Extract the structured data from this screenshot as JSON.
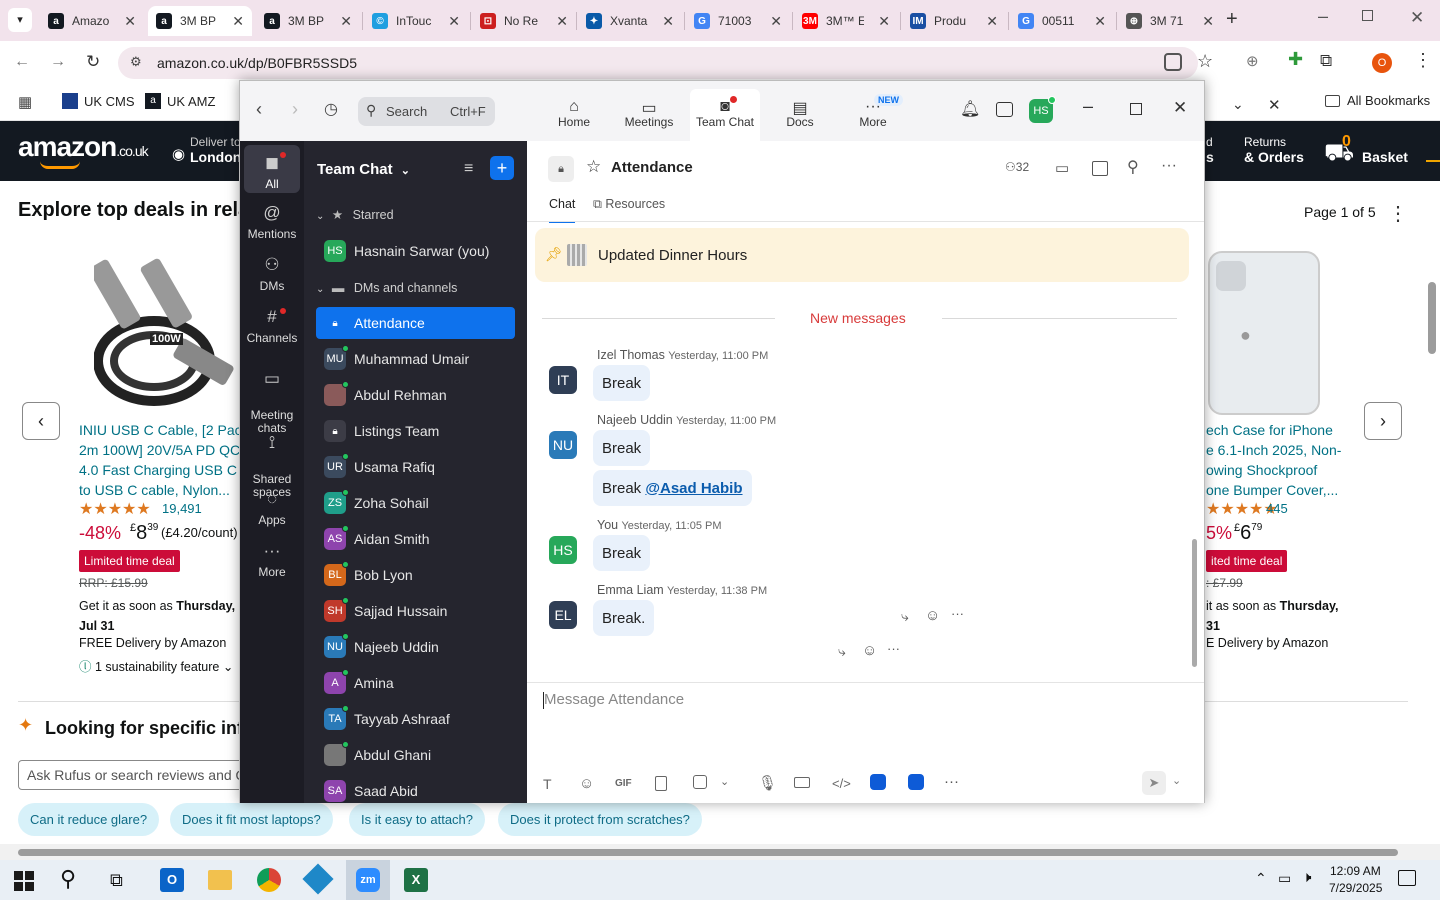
{
  "browser": {
    "tabs": [
      {
        "label": "Amazo",
        "color": "#131921",
        "fav": "a"
      },
      {
        "label": "3M BP",
        "color": "#131921",
        "fav": "a"
      },
      {
        "label": "3M BP",
        "color": "#131921",
        "fav": "a"
      },
      {
        "label": "InTouc",
        "color": "#1f9fe0",
        "fav": "©"
      },
      {
        "label": "No Re",
        "color": "#cc1f1f",
        "fav": "⊡"
      },
      {
        "label": "Xvanta",
        "color": "#0a5aa8",
        "fav": "✦"
      },
      {
        "label": "71003",
        "color": "#4285f4",
        "fav": "G"
      },
      {
        "label": "3M™ E",
        "color": "#ff0000",
        "fav": "3M"
      },
      {
        "label": "Produ",
        "color": "#1a4fa3",
        "fav": "IM"
      },
      {
        "label": "00511",
        "color": "#4285f4",
        "fav": "G"
      },
      {
        "label": "3M 71",
        "color": "#555555",
        "fav": "⊕"
      }
    ],
    "new_tab": "+",
    "url": "amazon.co.uk/dp/B0FBR5SSD5",
    "bookmarks": [
      "UK CMS",
      "UK AMZ"
    ],
    "all_bookmarks": "All Bookmarks",
    "profile_initial": "O"
  },
  "amazon": {
    "logo": "amazon",
    "logo_suffix": ".co.uk",
    "deliver_line1": "Deliver to",
    "deliver_line2": "London",
    "returns_line1": "Returns",
    "returns_line2": "& Orders",
    "lists_line1": "d",
    "lists_line2": "s",
    "basket_count": "0",
    "basket_label": "Basket",
    "section_title": "Explore top deals in rela",
    "page_indicator": "Page 1 of 5",
    "left_product": {
      "cable_label": "100W",
      "title": [
        "INIU USB C Cable, [2 Pack",
        "2m 100W] 20V/5A PD QC",
        "4.0 Fast Charging USB C",
        "to USB C cable, Nylon..."
      ],
      "stars": "★★★★★",
      "reviews": "19,491",
      "discount": "-48%",
      "price_symbol": "£",
      "price_whole": "8",
      "price_frac": "39",
      "unit_price": "(£4.20/count)",
      "deal": "Limited time deal",
      "rrp": "RRP: £15.99",
      "delivery_prefix": "Get it as soon as ",
      "delivery_day": "Thursday,",
      "delivery_date": "Jul 31",
      "free_delivery": "FREE Delivery by Amazon",
      "sustainability": "1 sustainability feature"
    },
    "right_product": {
      "title": [
        "ech Case for iPhone",
        "e 6.1-Inch 2025, Non-",
        "owing Shockproof",
        "one Bumper Cover,..."
      ],
      "stars": "★★★★★",
      "reviews": "445",
      "discount": "5%",
      "price_symbol": "£",
      "price_whole": "6",
      "price_frac": "79",
      "deal": "ited time deal",
      "rrp": ": £7.99",
      "delivery_prefix": "it as soon as ",
      "delivery_day": "Thursday,",
      "delivery_date": "31",
      "free_delivery": "E Delivery by Amazon"
    },
    "rufus_title": "Looking for specific inf",
    "rufus_placeholder": "Ask Rufus or search reviews and Q",
    "questions": [
      "Can it reduce glare?",
      "Does it fit most laptops?",
      "Is it easy to attach?",
      "Does it protect from scratches?"
    ]
  },
  "zoom": {
    "search_label": "Search",
    "search_shortcut": "Ctrl+F",
    "top_tabs": [
      {
        "label": "Home",
        "icon": "⌂"
      },
      {
        "label": "Meetings",
        "icon": "▭"
      },
      {
        "label": "Team Chat",
        "icon": "◙"
      },
      {
        "label": "Docs",
        "icon": "▤"
      },
      {
        "label": "More",
        "icon": "···"
      }
    ],
    "new_badge": "NEW",
    "user_initials": "HS",
    "rail": [
      {
        "label": "All",
        "icon": "◼"
      },
      {
        "label": "Mentions",
        "icon": "@"
      },
      {
        "label": "DMs",
        "icon": "⚇"
      },
      {
        "label": "Channels",
        "icon": "#"
      },
      {
        "label": "Meeting\nchats",
        "icon": "▭"
      },
      {
        "label": "Shared\nspaces",
        "icon": "⟟"
      },
      {
        "label": "Apps",
        "icon": "◌"
      },
      {
        "label": "More",
        "icon": "···"
      }
    ],
    "list_title": "Team Chat",
    "starred_label": "Starred",
    "starred_item": {
      "name": "Hasnain Sarwar (you)",
      "initials": "HS",
      "color": "#27a85a"
    },
    "dms_label": "DMs and channels",
    "list": [
      {
        "name": "Attendance",
        "initials": "",
        "color": "#0e72ed",
        "type": "channel"
      },
      {
        "name": "Muhammad Umair",
        "initials": "MU",
        "color": "#3b4a5e",
        "type": "dm"
      },
      {
        "name": "Abdul Rehman",
        "initials": "",
        "color": "#8a5a5a",
        "type": "photo"
      },
      {
        "name": "Listings Team",
        "initials": "",
        "color": "#3c3c46",
        "type": "channel"
      },
      {
        "name": "Usama Rafiq",
        "initials": "UR",
        "color": "#3b4a5e",
        "type": "dm"
      },
      {
        "name": "Zoha Sohail",
        "initials": "ZS",
        "color": "#1f9e8a",
        "type": "dm"
      },
      {
        "name": "Aidan Smith",
        "initials": "AS",
        "color": "#8e44ad",
        "type": "dm"
      },
      {
        "name": "Bob Lyon",
        "initials": "BL",
        "color": "#d4681b",
        "type": "dm"
      },
      {
        "name": "Sajjad Hussain",
        "initials": "SH",
        "color": "#c0392b",
        "type": "dm"
      },
      {
        "name": "Najeeb Uddin",
        "initials": "NU",
        "color": "#2a7ab8",
        "type": "dm"
      },
      {
        "name": "Amina",
        "initials": "A",
        "color": "#8e44ad",
        "type": "dm"
      },
      {
        "name": "Tayyab Ashraaf",
        "initials": "TA",
        "color": "#2a7ab8",
        "type": "dm"
      },
      {
        "name": "Abdul Ghani",
        "initials": "",
        "color": "#777",
        "type": "photo"
      },
      {
        "name": "Saad Abid",
        "initials": "SA",
        "color": "#8e44ad",
        "type": "dm"
      }
    ],
    "channel_title": "Attendance",
    "member_count": "32",
    "chat_tabs": [
      "Chat",
      "Resources"
    ],
    "pinned_text": "Updated Dinner Hours",
    "new_messages": "New messages",
    "messages": [
      {
        "initials": "IT",
        "color": "#2f3e55",
        "name": "Izel Thomas",
        "time": "Yesterday, 11:00 PM",
        "texts": [
          "Break"
        ]
      },
      {
        "initials": "NU",
        "color": "#2a7ab8",
        "name": "Najeeb Uddin",
        "time": "Yesterday, 11:00 PM",
        "texts": [
          "Break",
          "Break "
        ],
        "mention": "@Asad Habib"
      },
      {
        "initials": "HS",
        "color": "#27a85a",
        "name": "You",
        "time": "Yesterday, 11:05 PM",
        "texts": [
          "Break"
        ]
      },
      {
        "initials": "EL",
        "color": "#2f3e55",
        "name": "Emma Liam",
        "time": "Yesterday, 11:38 PM",
        "texts": [
          "Break."
        ]
      }
    ],
    "composer_placeholder": "Message Attendance"
  },
  "taskbar": {
    "time": "12:09 AM",
    "date": "7/29/2025"
  }
}
